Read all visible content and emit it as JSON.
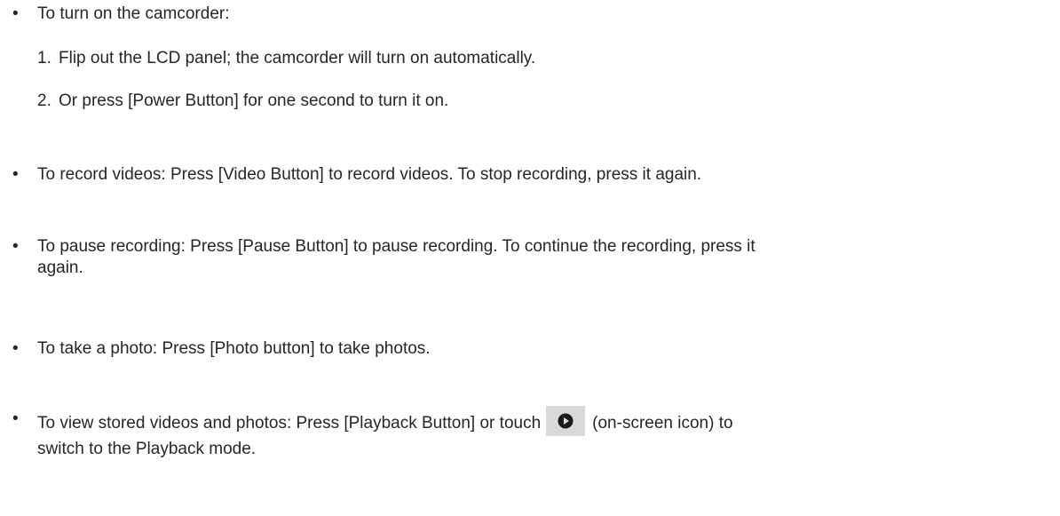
{
  "bullets": {
    "b1": {
      "text": "To turn on the camcorder:",
      "steps": [
        {
          "num": "1.",
          "text": "Flip out the LCD panel; the camcorder will turn on automatically."
        },
        {
          "num": "2.",
          "text": "Or press [Power Button] for one second to turn it on."
        }
      ]
    },
    "b2": {
      "text": "To record videos: Press [Video Button] to record videos. To stop recording, press it again."
    },
    "b3": {
      "line1": "To pause recording: Press [Pause Button] to pause recording. To continue the recording, press it",
      "line2": "again."
    },
    "b4": {
      "text": "To take a photo: Press [Photo button] to take photos."
    },
    "b5": {
      "before_icon": "To view stored videos and photos: Press [Playback Button] or touch",
      "after_icon": "(on-screen icon) to",
      "line2": "switch to the Playback mode.",
      "icon": "play-circle-icon"
    }
  },
  "bullet_glyph": "•",
  "colors": {
    "text": "#262626",
    "icon_bg": "#d9d9d9",
    "icon_fg": "#1a1a1a"
  }
}
